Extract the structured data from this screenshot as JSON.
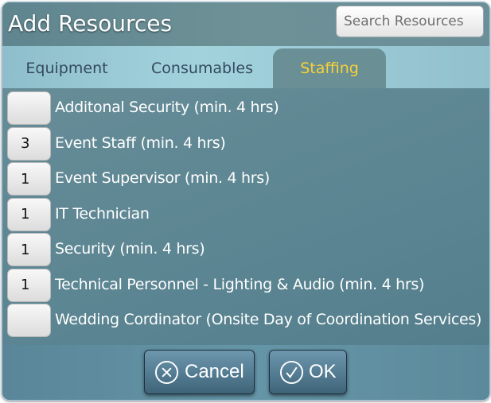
{
  "dialog": {
    "title": "Add Resources",
    "search": {
      "placeholder": "Search Resources",
      "value": ""
    }
  },
  "tabs": [
    {
      "label": "Equipment",
      "active": false
    },
    {
      "label": "Consumables",
      "active": false
    },
    {
      "label": "Staffing",
      "active": true
    }
  ],
  "items": [
    {
      "quantity": "",
      "label": "Additonal Security (min. 4 hrs)"
    },
    {
      "quantity": "3",
      "label": "Event Staff (min. 4 hrs)"
    },
    {
      "quantity": "1",
      "label": "Event Supervisor (min. 4 hrs)"
    },
    {
      "quantity": "1",
      "label": "IT Technician"
    },
    {
      "quantity": "1",
      "label": "Security (min. 4 hrs)"
    },
    {
      "quantity": "1",
      "label": "Technical Personnel - Lighting & Audio (min. 4 hrs)"
    },
    {
      "quantity": "",
      "label": "Wedding Cordinator (Onsite Day of Coordination Services)"
    }
  ],
  "footer": {
    "cancel_label": "Cancel",
    "cancel_icon": "circle-x-icon",
    "ok_label": "OK",
    "ok_icon": "circle-check-icon"
  },
  "colors": {
    "active_tab_text": "#f7d136",
    "tab_text": "#34495e"
  }
}
